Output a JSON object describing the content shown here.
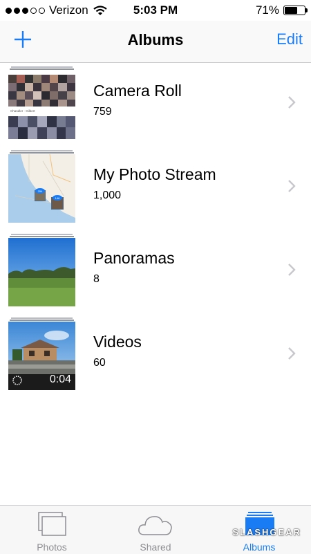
{
  "status_bar": {
    "carrier": "Verizon",
    "time": "5:03 PM",
    "battery_percent": "71%",
    "battery_level": 0.71,
    "signal_bars": 3,
    "signal_total": 5
  },
  "nav": {
    "title": "Albums",
    "add_icon": "plus-icon",
    "edit_label": "Edit"
  },
  "albums": [
    {
      "title": "Camera Roll",
      "count": "759",
      "thumb_text": "Chandler · Gilbert"
    },
    {
      "title": "My Photo Stream",
      "count": "1,000",
      "thumb_badges": [
        "254",
        "146"
      ]
    },
    {
      "title": "Panoramas",
      "count": "8"
    },
    {
      "title": "Videos",
      "count": "60",
      "duration": "0:04"
    }
  ],
  "tabs": [
    {
      "label": "Photos",
      "icon": "photos-icon",
      "active": false
    },
    {
      "label": "Shared",
      "icon": "cloud-icon",
      "active": false
    },
    {
      "label": "Albums",
      "icon": "albums-icon",
      "active": true
    }
  ],
  "watermark": "SLASHGEAR",
  "colors": {
    "accent": "#1a7cf5",
    "inactive": "#8e8e93",
    "separator": "#c8c7cc"
  }
}
